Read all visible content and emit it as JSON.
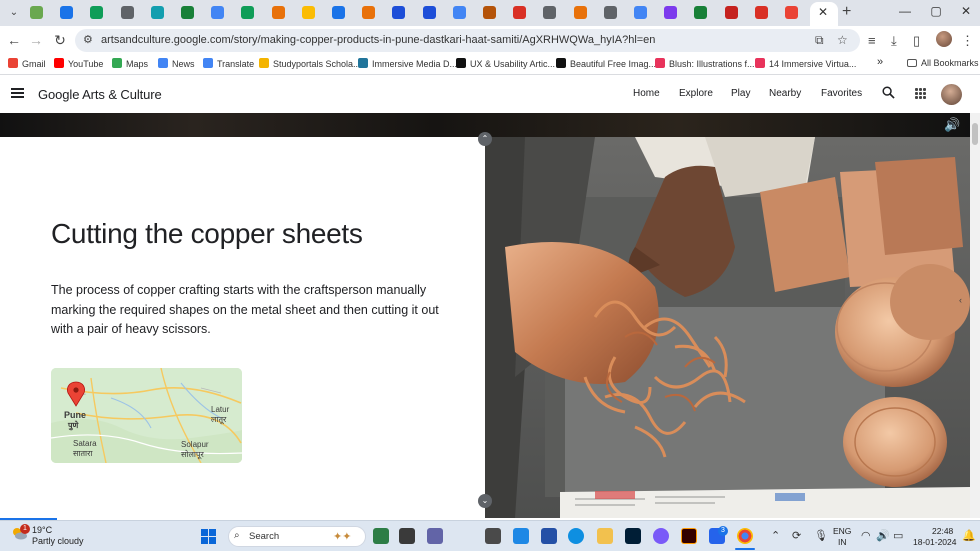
{
  "browser": {
    "tabs_menu_icon": "chevron-down-icon",
    "active_tab_close": "✕",
    "new_tab": "+",
    "window_controls": [
      "—",
      "▢",
      "✕"
    ],
    "tab_favicon_colors": [
      "#6aa84f",
      "#1a73e8",
      "#0f9d58",
      "#5f6368",
      "#129eaf",
      "#188038",
      "#4285f4",
      "#0f9d58",
      "#e8710a",
      "#fbbc04",
      "#1a73e8",
      "#e8710a",
      "#1d4ed8",
      "#1d4ed8",
      "#4285f4",
      "#b45309",
      "#d93025",
      "#5f6368",
      "#e8710a",
      "#5f6368",
      "#4285f4",
      "#7c3aed",
      "#188038",
      "#c5221f",
      "#d93025",
      "#ea4335"
    ],
    "url": "artsandculture.google.com/story/making-copper-products-in-pune-dastkari-haat-samiti/AgXRHWQWa_hyIA?hl=en"
  },
  "bookmarks": [
    {
      "label": "Gmail",
      "color": "#ea4335"
    },
    {
      "label": "YouTube",
      "color": "#ff0000"
    },
    {
      "label": "Maps",
      "color": "#34a853"
    },
    {
      "label": "News",
      "color": "#4285f4"
    },
    {
      "label": "Translate",
      "color": "#4285f4"
    },
    {
      "label": "Studyportals Schola...",
      "color": "#f4b400"
    },
    {
      "label": "Immersive Media D...",
      "color": "#21759b"
    },
    {
      "label": "UX & Usability Artic...",
      "color": "#111111"
    },
    {
      "label": "Beautiful Free Imag...",
      "color": "#111111"
    },
    {
      "label": "Blush: Illustrations f...",
      "color": "#e8335b"
    },
    {
      "label": "14 Immersive Virtua...",
      "color": "#e8335b"
    }
  ],
  "bookmarks_more": "»",
  "all_bookmarks": "All Bookmarks",
  "site": {
    "logo": "Google Arts & Culture",
    "nav": [
      "Home",
      "Explore",
      "Play",
      "Nearby",
      "Favorites"
    ]
  },
  "story": {
    "heading": "Cutting the copper sheets",
    "body": "The process  of copper crafting starts with the craftsperson manually marking the required shapes on the metal sheet and then cutting it out with a pair of heavy scissors.",
    "map_labels": {
      "pune": "Pune",
      "pune_marathi": "पुणे",
      "latur": "Latur",
      "latur_marathi": "लातूर",
      "satara": "Satara",
      "satara_marathi": "सातारा",
      "solapur": "Solapur",
      "solapur_marathi": "सोलापूर"
    }
  },
  "taskbar": {
    "weather_temp": "19°C",
    "weather_desc": "Partly cloudy",
    "notification_count": "1",
    "search_placeholder": "Search",
    "language": "ENG",
    "region": "IN",
    "time": "22:48",
    "date": "18-01-2024",
    "teams_badge": "3"
  }
}
